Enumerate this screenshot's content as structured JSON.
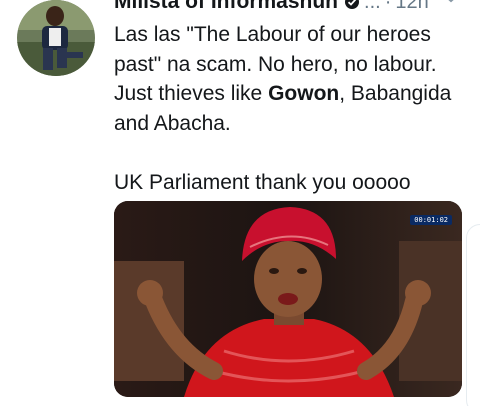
{
  "tweet": {
    "display_name": "Millsta of Informashun",
    "handle_dots": "...",
    "time_separator": "·",
    "timestamp": "12h",
    "text": {
      "line1": "Las las \"The Labour of our heroes",
      "line2": "past\" na scam. No hero, no labour.",
      "line3_pre": "Just thieves like ",
      "line3_bold": "Gowon",
      "line3_post": ", Babangida",
      "line4": "and Abacha.",
      "line5": "UK Parliament thank you ooooo"
    },
    "media": {
      "video_timer": "00:01:02"
    }
  },
  "icons": [
    "verified-icon",
    "chevron-down-icon"
  ],
  "colors": {
    "text": "#14171a",
    "secondary": "#657786",
    "timer_bg": "#0a2a63",
    "headwrap_red": "#c8102e",
    "dress_red": "#d0161c"
  }
}
